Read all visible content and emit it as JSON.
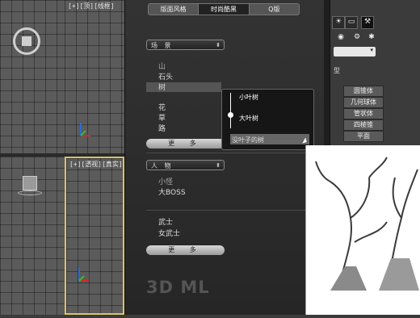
{
  "viewports": {
    "top_left_label": "[+][顶][线框]",
    "bottom_left_label": "[+][透视][真实]"
  },
  "panel": {
    "tabs": [
      {
        "label": "版面风格",
        "active": false
      },
      {
        "label": "时尚酷黑",
        "active": true
      },
      {
        "label": "Q版",
        "active": false
      }
    ],
    "scene_dropdown": "场 景",
    "scene_items": [
      "山",
      "石头",
      "树",
      "花",
      "草",
      "路"
    ],
    "selected_item": "树",
    "more_label": "更 多",
    "character_dropdown": "人 物",
    "character_items": [
      "小怪",
      "大BOSS"
    ],
    "warrior_items": [
      "武士",
      "女武士"
    ],
    "logo_text": "3D ML"
  },
  "flyout": {
    "items": [
      "小叶树",
      "大叶树",
      "没叶子的树"
    ],
    "selected_index": 0
  },
  "command_panel": {
    "buttons": [
      "圆锥体",
      "几何球体",
      "管状体",
      "四棱锥",
      "平面"
    ],
    "header": "型"
  },
  "colors": {
    "panel_bg": "#2b2b2b",
    "viewport_bg": "#5b5b5b",
    "active_viewport_border": "#d9c36a"
  }
}
